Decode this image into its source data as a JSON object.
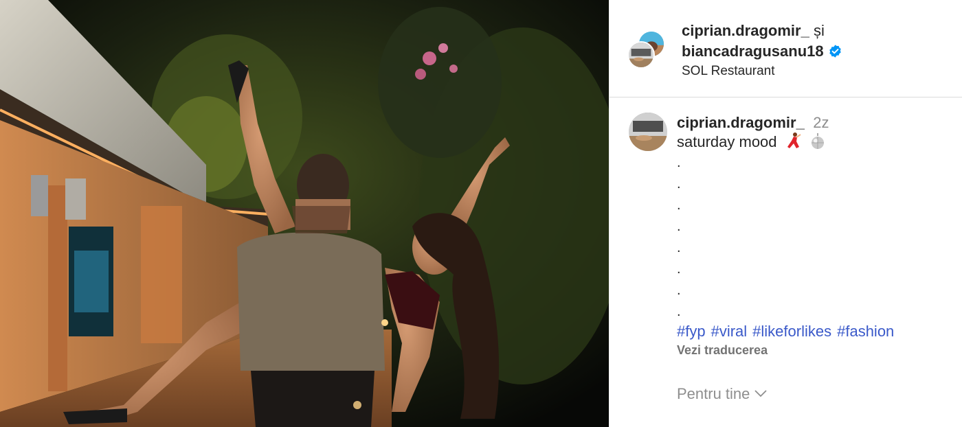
{
  "post": {
    "header": {
      "author": "ciprian.dragomir_",
      "conjunction": "și",
      "collaborator": "biancadragusanu18",
      "location": "SOL Restaurant",
      "verified_color": "#0095f6"
    },
    "caption": {
      "username": "ciprian.dragomir_",
      "time": "2z",
      "text": "saturday mood",
      "emojis": [
        "dancer-emoji",
        "mirror-ball-emoji"
      ],
      "dots": [
        ".",
        ".",
        ".",
        ".",
        ".",
        ".",
        ".",
        "."
      ],
      "hashtags": [
        "#fyp",
        "#viral",
        "#likeforlikes",
        "#fashion"
      ],
      "translate_label": "Vezi traducerea"
    },
    "for_you_label": "Pentru tine",
    "colors": {
      "link": "#3a59c9",
      "muted": "#8e8e8e",
      "text": "#262626"
    }
  }
}
